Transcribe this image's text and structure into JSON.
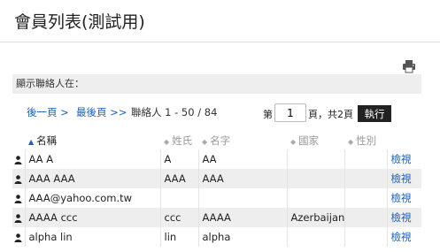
{
  "page": {
    "title": "會員列表(測試用)"
  },
  "filter": {
    "label": "顯示聯絡人在："
  },
  "pager": {
    "prev": "後一頁 >",
    "last": "最後頁 >>",
    "count": "聯絡人 1 - 50 / 84",
    "page_prefix": "第",
    "page_value": "1",
    "page_suffix": "頁，共2頁",
    "exec": "執行"
  },
  "table": {
    "headers": [
      "名稱",
      "姓氏",
      "名字",
      "國家",
      "性別"
    ],
    "rows": [
      {
        "name": "AA A",
        "last": "A",
        "first": "AA",
        "country": "",
        "gender": "",
        "view": "檢視"
      },
      {
        "name": "AAA AAA",
        "last": "AAA",
        "first": "AAA",
        "country": "",
        "gender": "",
        "view": "檢視"
      },
      {
        "name": "AAA@yahoo.com.tw",
        "last": "",
        "first": "",
        "country": "",
        "gender": "",
        "view": "檢視"
      },
      {
        "name": "AAAA ccc",
        "last": "ccc",
        "first": "AAAA",
        "country": "Azerbaijan",
        "gender": "",
        "view": "檢視"
      },
      {
        "name": "alpha lin",
        "last": "lin",
        "first": "alpha",
        "country": "",
        "gender": "",
        "view": "檢視"
      }
    ]
  },
  "icons": {
    "print": "printer-icon",
    "person": "person-icon",
    "sort": "sort-icon"
  }
}
